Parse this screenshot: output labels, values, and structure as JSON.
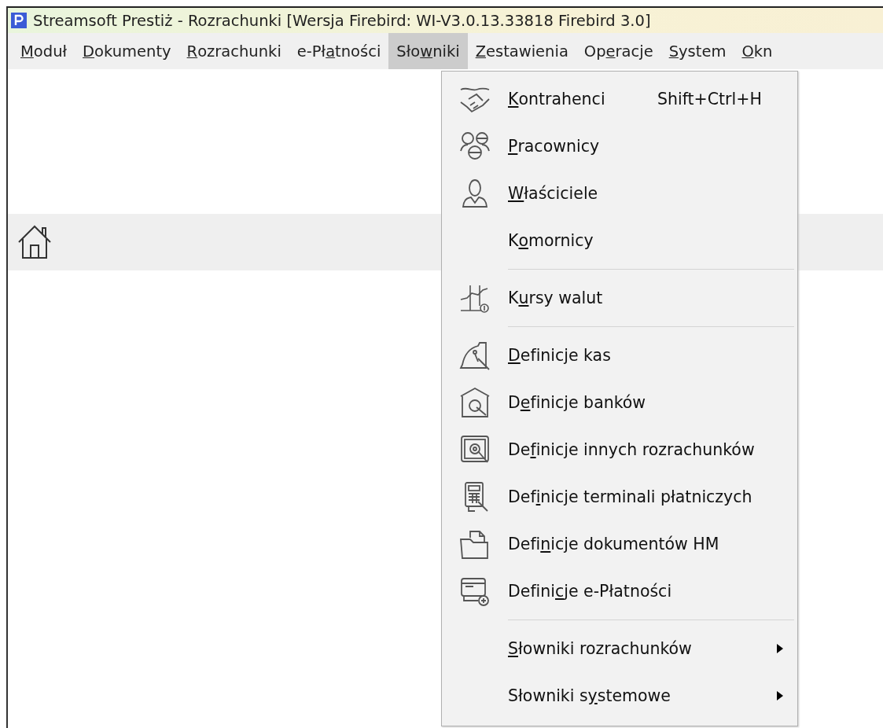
{
  "window": {
    "title": "Streamsoft Prestiż - Rozrachunki [Wersja Firebird: WI-V3.0.13.33818 Firebird 3.0]"
  },
  "menu_bar": [
    {
      "mnemonic": "M",
      "after": "oduł",
      "selected": false
    },
    {
      "mnemonic": "D",
      "after": "okumenty",
      "selected": false
    },
    {
      "mnemonic": "R",
      "after": "ozrachunki",
      "selected": false
    },
    {
      "before": "e-Pł",
      "mnemonic": "a",
      "after": "tności",
      "selected": false
    },
    {
      "before": "Sło",
      "mnemonic": "w",
      "after": "niki",
      "selected": true
    },
    {
      "mnemonic": "Z",
      "after": "estawienia",
      "selected": false
    },
    {
      "before": "Op",
      "mnemonic": "e",
      "after": "racje",
      "selected": false
    },
    {
      "mnemonic": "S",
      "after": "ystem",
      "selected": false
    },
    {
      "mnemonic": "O",
      "after": "kn",
      "selected": false
    }
  ],
  "dropdown": [
    {
      "kind": "item",
      "mnemonic": "K",
      "after": "ontrahenci",
      "shortcut": "Shift+Ctrl+H"
    },
    {
      "kind": "item",
      "mnemonic": "P",
      "after": "racownicy"
    },
    {
      "kind": "item",
      "mnemonic": "W",
      "after": "łaściciele"
    },
    {
      "kind": "item",
      "before": "K",
      "mnemonic": "o",
      "after": "mornicy"
    },
    {
      "kind": "separator"
    },
    {
      "kind": "item",
      "before": "K",
      "mnemonic": "u",
      "after": "rsy walut"
    },
    {
      "kind": "separator"
    },
    {
      "kind": "item",
      "mnemonic": "D",
      "after": "efinicje kas"
    },
    {
      "kind": "item",
      "before": "D",
      "mnemonic": "e",
      "after": "finicje banków"
    },
    {
      "kind": "item",
      "before": "De",
      "mnemonic": "f",
      "after": "inicje innych rozrachunków"
    },
    {
      "kind": "item",
      "before": "Def",
      "mnemonic": "i",
      "after": "nicje terminali płatniczych"
    },
    {
      "kind": "item",
      "before": "Defi",
      "mnemonic": "n",
      "after": "icje dokumentów HM"
    },
    {
      "kind": "item",
      "before": "Defini",
      "mnemonic": "c",
      "after": "je e-Płatności"
    },
    {
      "kind": "separator"
    },
    {
      "kind": "submenu",
      "mnemonic": "S",
      "after": "łowniki rozrachunków"
    },
    {
      "kind": "submenu",
      "before": "Słowniki s",
      "mnemonic": "y",
      "after": "stemowe"
    }
  ]
}
